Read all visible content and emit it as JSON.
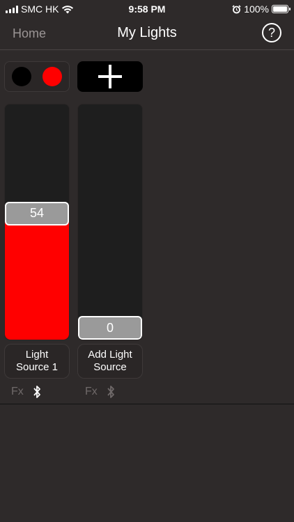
{
  "status_bar": {
    "carrier": "SMC HK",
    "time": "9:58 PM",
    "battery": "100%",
    "icons": [
      "signal-icon",
      "wifi-icon",
      "alarm-icon",
      "battery-icon"
    ]
  },
  "nav": {
    "back_label": "Home",
    "title": "My Lights",
    "help_label": "?"
  },
  "colors": {
    "background": "#2e2a2a",
    "accent_red": "#ff0000",
    "track": "#1e1e1e",
    "thumb": "#9a9a9a"
  },
  "controls": {
    "color_toggle": {
      "options": [
        "black",
        "red"
      ],
      "icons": [
        "black-dot-icon",
        "red-dot-icon"
      ]
    },
    "add_button_icon": "plus-icon"
  },
  "light_sources": [
    {
      "label": "Light\nSource 1",
      "value": "54",
      "level": 0.54,
      "fx": "Fx",
      "bluetooth_active": true
    },
    {
      "label": "Add Light\nSource",
      "value": "0",
      "level": 0.0,
      "fx": "Fx",
      "bluetooth_active": false
    }
  ]
}
